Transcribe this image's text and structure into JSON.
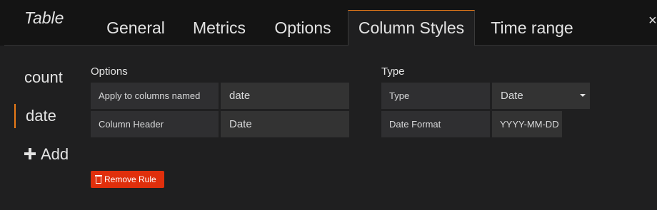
{
  "panel": {
    "title": "Table",
    "close_glyph": "×"
  },
  "tabs": [
    {
      "label": "General"
    },
    {
      "label": "Metrics"
    },
    {
      "label": "Options"
    },
    {
      "label": "Column Styles",
      "active": true
    },
    {
      "label": "Time range"
    }
  ],
  "sidebar": {
    "items": [
      {
        "label": "count"
      },
      {
        "label": "date",
        "active": true
      }
    ],
    "add_label": "Add"
  },
  "options": {
    "title": "Options",
    "apply_label": "Apply to columns named",
    "apply_value": "date",
    "header_label": "Column Header",
    "header_value": "Date"
  },
  "type_section": {
    "title": "Type",
    "type_label": "Type",
    "type_value": "Date",
    "format_label": "Date Format",
    "format_value": "YYYY-MM-DD"
  },
  "remove_button": {
    "label": "Remove Rule"
  },
  "colors": {
    "accent": "#eb7b18",
    "danger": "#e02f0c"
  },
  "icons": {
    "add": "plus-icon",
    "remove": "trash-icon",
    "close": "close-icon",
    "dropdown": "caret-down-icon"
  }
}
